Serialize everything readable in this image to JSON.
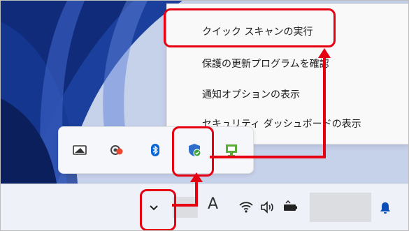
{
  "context_menu": {
    "items": [
      {
        "label": "クイック スキャンの実行"
      },
      {
        "label": "保護の更新プログラムを確認"
      },
      {
        "label": "通知オプションの表示"
      },
      {
        "label": "セキュリティ ダッシュボードの表示"
      }
    ]
  },
  "tray_flyout": {
    "icons": [
      "display-icon",
      "network-status-icon",
      "bluetooth-icon",
      "windows-security-icon",
      "monitor-icon"
    ]
  },
  "taskbar": {
    "chevron_icon": "chevron-up-icon",
    "ime_label": "A",
    "icons": [
      "wifi-icon",
      "speaker-icon",
      "battery-icon",
      "notification-bell-icon"
    ]
  },
  "colors": {
    "highlight": "#e60012",
    "accent_blue": "#0067c0",
    "security_green": "#3aa33a"
  }
}
